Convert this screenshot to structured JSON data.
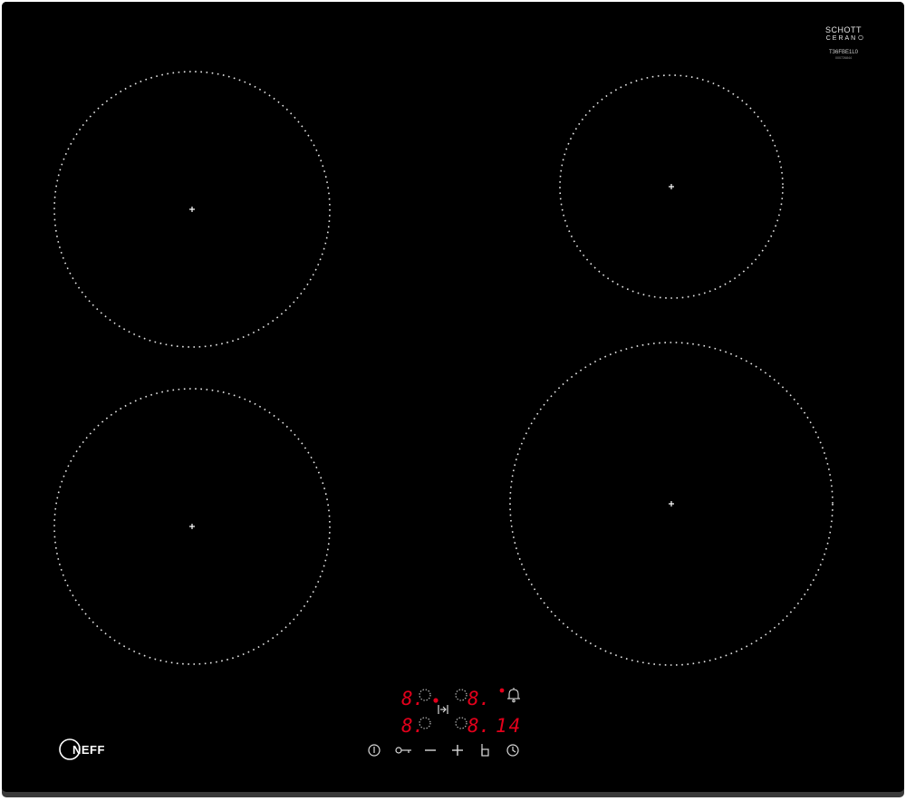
{
  "brand": {
    "logo_text": "NEFF",
    "glass_maker_line1": "SCHOTT",
    "glass_maker_line2": "CERAN",
    "model_code": "T36FBE1L0",
    "serial_code": "000726844"
  },
  "zones": [
    {
      "name": "front-left-zone"
    },
    {
      "name": "back-left-zone"
    },
    {
      "name": "back-right-zone"
    },
    {
      "name": "front-right-zone"
    }
  ],
  "control_panel": {
    "displays": {
      "back_left_level": "8.",
      "back_right_level": "8.",
      "front_left_level": "8.",
      "front_right_level": "8.",
      "timer_value": "14"
    },
    "colors": {
      "display_red": "#e3001b",
      "symbol_white": "#d9d9d9",
      "glass_black": "#000000",
      "frame_grey": "#3a3a3a"
    },
    "buttons": [
      {
        "name": "power-button",
        "icon": "power-icon"
      },
      {
        "name": "childlock-button",
        "icon": "key-icon"
      },
      {
        "name": "minus-button",
        "icon": "minus-icon"
      },
      {
        "name": "plus-button",
        "icon": "plus-icon"
      },
      {
        "name": "boost-button",
        "icon": "boost-icon"
      },
      {
        "name": "timer-button",
        "icon": "clock-icon"
      }
    ]
  }
}
